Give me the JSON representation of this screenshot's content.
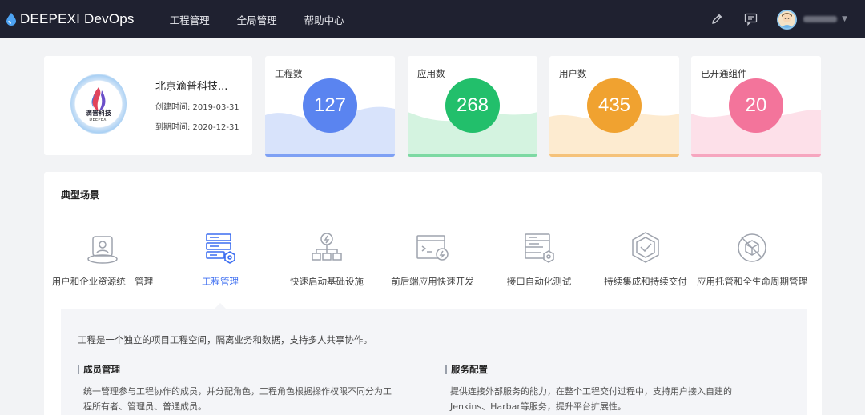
{
  "brand": {
    "name": "DEEPEXI DevOps"
  },
  "nav": {
    "items": [
      "工程管理",
      "全局管理",
      "帮助中心"
    ]
  },
  "company": {
    "logo_name": "滴普科技",
    "logo_sub": "DEEPEXI",
    "name": "北京滴普科技...",
    "created": "创建时间: 2019-03-31",
    "expires": "到期时间: 2020-12-31"
  },
  "stats": [
    {
      "label": "工程数",
      "value": "127",
      "color": "#5a84f0",
      "wave": "#d8e3fb",
      "bar": "#7ea0f4"
    },
    {
      "label": "应用数",
      "value": "268",
      "color": "#22bf6b",
      "wave": "#d4f3e0",
      "bar": "#7dd9a3"
    },
    {
      "label": "用户数",
      "value": "435",
      "color": "#f0a230",
      "wave": "#fdebd0",
      "bar": "#f5c27a"
    },
    {
      "label": "已开通组件",
      "value": "20",
      "color": "#f3749b",
      "wave": "#fde0e9",
      "bar": "#f6a6bf"
    }
  ],
  "scenarios": {
    "title": "典型场景",
    "items": [
      {
        "label": "用户和企业资源统一管理",
        "icon": "user-resource-icon"
      },
      {
        "label": "工程管理",
        "icon": "project-management-icon"
      },
      {
        "label": "快速启动基础设施",
        "icon": "infrastructure-icon"
      },
      {
        "label": "前后端应用快速开发",
        "icon": "dev-console-icon"
      },
      {
        "label": "接口自动化测试",
        "icon": "api-test-icon"
      },
      {
        "label": "持续集成和持续交付",
        "icon": "ci-cd-icon"
      },
      {
        "label": "应用托管和全生命周期管理",
        "icon": "lifecycle-icon"
      }
    ],
    "active_index": 1
  },
  "detail": {
    "description": "工程是一个独立的项目工程空间，隔离业务和数据，支持多人共享协作。",
    "member": {
      "title": "成员管理",
      "line1": "统一管理参与工程协作的成员，并分配角色，工程角色根据操作权限不同分为工",
      "line2": "程所有者、管理员、普通成员。"
    },
    "service": {
      "title": "服务配置",
      "line1": "提供连接外部服务的能力，在整个工程交付过程中，支持用户接入自建的",
      "line2": "Jenkins、Harbar等服务，提升平台扩展性。"
    }
  },
  "colors": {
    "accent": "#3b6df1",
    "topbar": "#1f2130"
  }
}
